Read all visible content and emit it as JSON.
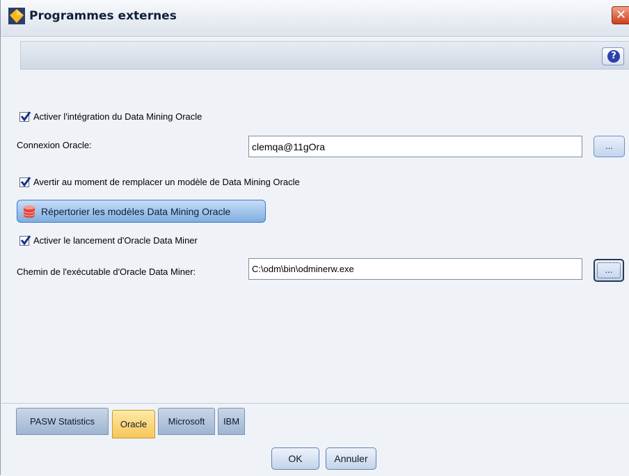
{
  "window": {
    "title": "Programmes externes",
    "title_icon": "diamond-icon",
    "close_glyph": "✕",
    "help_glyph": "?"
  },
  "oracle": {
    "enable_integration": {
      "label": "Activer l'intégration du Data Mining Oracle",
      "checked": true
    },
    "connection": {
      "label": "Connexion Oracle:",
      "value": "clemqa@11gOra",
      "browse_label": "..."
    },
    "warn_replace": {
      "label": "Avertir au moment de remplacer un modèle de Data Mining Oracle",
      "checked": true
    },
    "list_models_button": "Répertorier les modèles Data Mining Oracle",
    "enable_launch": {
      "label": "Activer le lancement d'Oracle Data Miner",
      "checked": true
    },
    "executable_path": {
      "label": "Chemin de l'exécutable d'Oracle Data Miner:",
      "value": "C:\\odm\\bin\\odminerw.exe",
      "browse_label": "..."
    }
  },
  "tabs": [
    {
      "label": "PASW Statistics",
      "active": false
    },
    {
      "label": "Oracle",
      "active": true
    },
    {
      "label": "Microsoft",
      "active": false
    },
    {
      "label": "IBM",
      "active": false
    }
  ],
  "buttons": {
    "ok": "OK",
    "cancel": "Annuler"
  },
  "colors": {
    "active_tab": "#f8c65a",
    "window_bg": "#eff2f7",
    "accent_blue": "#7faee0"
  }
}
